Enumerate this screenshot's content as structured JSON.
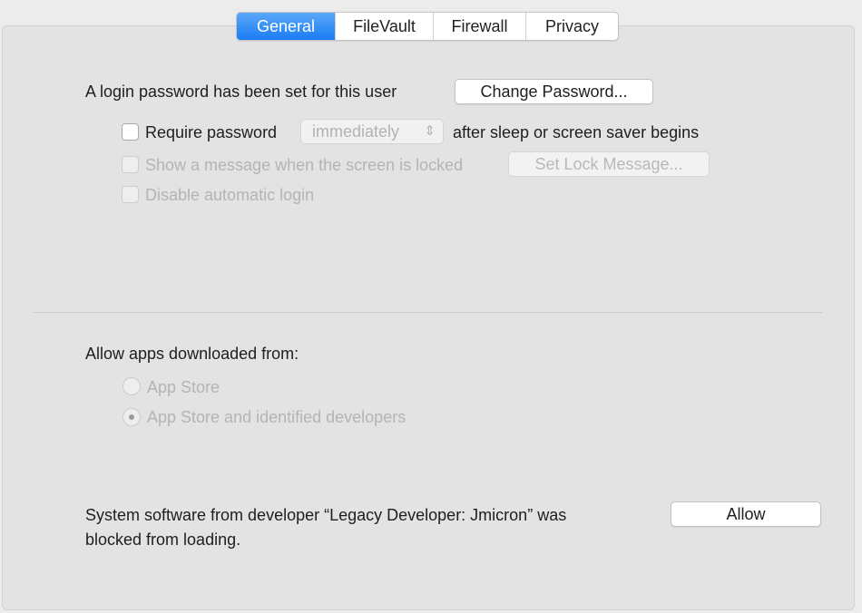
{
  "tabs": [
    {
      "label": "General",
      "active": true
    },
    {
      "label": "FileVault",
      "active": false
    },
    {
      "label": "Firewall",
      "active": false
    },
    {
      "label": "Privacy",
      "active": false
    }
  ],
  "general": {
    "login_password_text": "A login password has been set for this user",
    "change_password_label": "Change Password...",
    "require_password_label": "Require password",
    "require_password_checked": false,
    "require_password_delay": "immediately",
    "after_sleep_text": "after sleep or screen saver begins",
    "show_message_label": "Show a message when the screen is locked",
    "set_lock_message_label": "Set Lock Message...",
    "disable_auto_login_label": "Disable automatic login"
  },
  "downloads": {
    "heading": "Allow apps downloaded from:",
    "options": [
      {
        "label": "App Store",
        "selected": false
      },
      {
        "label": "App Store and identified developers",
        "selected": true
      }
    ]
  },
  "blocked": {
    "line1": "System software from developer “Legacy Developer: Jmicron” was",
    "line2": "blocked from loading.",
    "allow_label": "Allow"
  },
  "colors": {
    "accent": "#1a7cf3",
    "panel": "#e3e3e3",
    "disabled_text": "#b4b4b4"
  }
}
